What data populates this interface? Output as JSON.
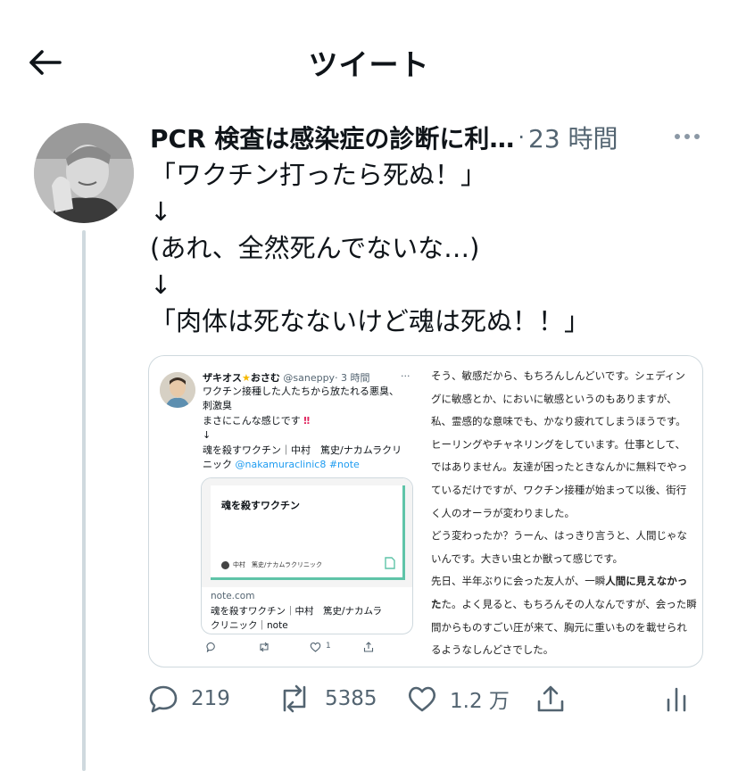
{
  "header": {
    "title": "ツイート"
  },
  "tweet": {
    "author_name": "PCR 検査は感染症の診断に利…",
    "time": "23 時間",
    "text_lines": [
      "「ワクチン打ったら死ぬ！」",
      "↓",
      "(あれ、全然死んでないな…)",
      "↓",
      "「肉体は死なないけど魂は死ぬ！！」"
    ]
  },
  "embedded_tweet": {
    "author_name": "ザキオス",
    "author_suffix": "おさむ",
    "handle": "@saneppy",
    "time": "· 3 時間",
    "more": "···",
    "lines": [
      "ワクチン接種した人たちから放たれる悪臭、",
      "刺激臭",
      "まさにこんな感じです",
      "↓",
      "魂を殺すワクチン｜中村　篤史/ナカムラクリ",
      "ニック"
    ],
    "mention": "@nakamuraclinic8",
    "hashtag": "#note",
    "bang": "‼",
    "card": {
      "title": "魂を殺すワクチン",
      "author": "中村　篤史/ナカムラクリニック",
      "domain": "note.com",
      "title_line1": "魂を殺すワクチン｜中村　篤史/ナカムラ",
      "title_line2": "クリニック｜note"
    },
    "actions": {
      "like_count": "1"
    }
  },
  "article_lines": [
    "そう、敏感だから、もちろんしんどいです。シェディン",
    "グに敏感とか、においに敏感というのもありますが、",
    "私、霊感的な意味でも、かなり疲れてしまうほうです。",
    "ヒーリングやチャネリングをしています。仕事として、",
    "ではありません。友達が困ったときなんかに無料でやっ",
    "ているだけですが、ワクチン接種が始まって以後、街行",
    "く人のオーラが変わりました。",
    "どう変わったか？うーん、はっきり言うと、人間じゃな",
    "いんです。大きい虫とか獣って感じです。",
    "先日、半年ぶりに会った友人が、一瞬",
    "た。よく見ると、もちろんその人なんですが、会った瞬",
    "間からものすごい圧が来て、胸元に重いものを載せられ",
    "るようなしんどさでした。"
  ],
  "article_bold_1": "人間に見えなかっ",
  "article_bold_2": "た",
  "stats": {
    "replies": "219",
    "retweets": "5385",
    "likes": "1.2 万"
  },
  "colors": {
    "accent": "#1d9bf0",
    "muted": "#536471",
    "thread_line": "#cfd9de"
  }
}
